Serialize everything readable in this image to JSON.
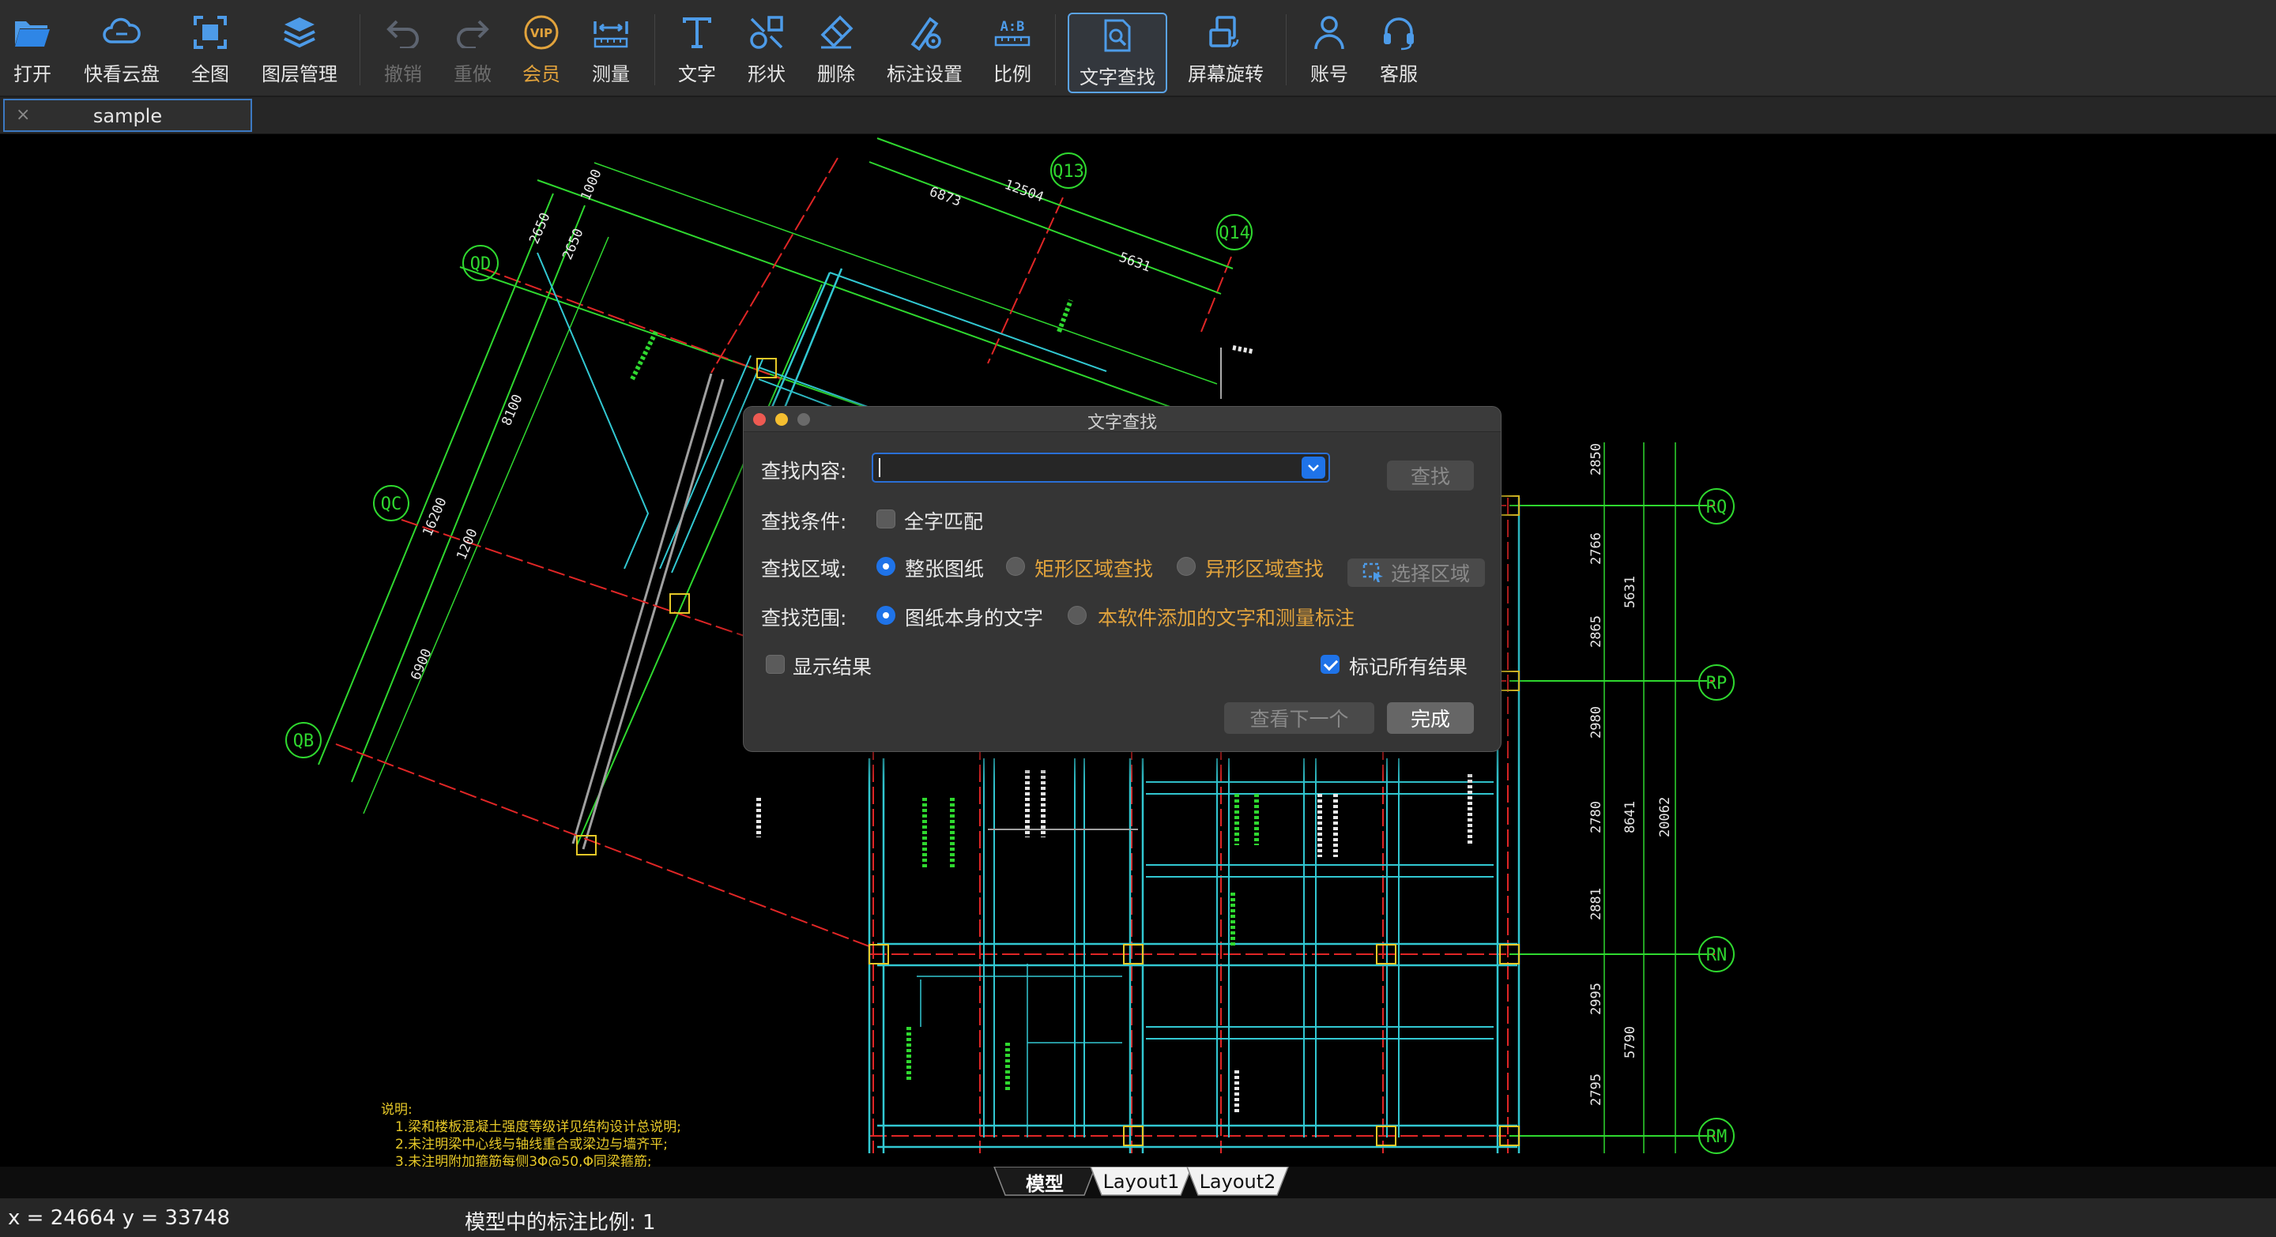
{
  "toolbar": {
    "items": [
      {
        "label": "打开",
        "icon": "folder-open-icon"
      },
      {
        "label": "快看云盘",
        "icon": "cloud-icon"
      },
      {
        "label": "全图",
        "icon": "fit-view-icon"
      },
      {
        "label": "图层管理",
        "icon": "layers-icon"
      },
      {
        "label": "撤销",
        "icon": "undo-icon",
        "disabled": true
      },
      {
        "label": "重做",
        "icon": "redo-icon",
        "disabled": true
      },
      {
        "label": "会员",
        "icon": "vip-icon"
      },
      {
        "label": "测量",
        "icon": "ruler-icon"
      },
      {
        "label": "文字",
        "icon": "text-icon"
      },
      {
        "label": "形状",
        "icon": "shape-icon"
      },
      {
        "label": "删除",
        "icon": "eraser-icon"
      },
      {
        "label": "标注设置",
        "icon": "annotation-settings-icon"
      },
      {
        "label": "比例",
        "icon": "scale-icon"
      },
      {
        "label": "文字查找",
        "icon": "text-search-icon",
        "active": true
      },
      {
        "label": "屏幕旋转",
        "icon": "screen-rotate-icon"
      },
      {
        "label": "账号",
        "icon": "account-icon"
      },
      {
        "label": "客服",
        "icon": "headset-icon"
      }
    ]
  },
  "tab": {
    "name": "sample",
    "close": "×"
  },
  "drawing": {
    "axes": [
      "QD",
      "QC",
      "QB",
      "Q13",
      "Q14",
      "RQ",
      "RP",
      "RN",
      "RM"
    ],
    "dims_top": [
      "6873",
      "12504",
      "5631"
    ],
    "dims_left": [
      "1000",
      "2650",
      "2650",
      "8100",
      "16200",
      "1200",
      "6900"
    ],
    "dims_right": [
      "2850",
      "2766",
      "2865",
      "2980",
      "2780",
      "2881",
      "2995",
      "2795",
      "5631",
      "8641",
      "20062",
      "5790"
    ],
    "notes_title": "说明:",
    "notes": [
      "1.梁和楼板混凝土强度等级详见结构设计总说明;",
      "2.未注明梁中心线与轴线重合或梁边与墙齐平;",
      "3.未注明附加箍筋每侧3Φ@50,Φ同梁箍筋;"
    ]
  },
  "dialog": {
    "title": "文字查找",
    "search_label": "查找内容:",
    "search_value": "",
    "search_button": "查找",
    "condition_label": "查找条件:",
    "whole_word": "全字匹配",
    "area_label": "查找区域:",
    "area_options": [
      "整张图纸",
      "矩形区域查找",
      "异形区域查找"
    ],
    "select_area": "选择区域",
    "scope_label": "查找范围:",
    "scope_options": [
      "图纸本身的文字",
      "本软件添加的文字和测量标注"
    ],
    "show_results": "显示结果",
    "mark_all": "标记所有结果",
    "next_button": "查看下一个",
    "done_button": "完成"
  },
  "layout_tabs": [
    "模型",
    "Layout1",
    "Layout2"
  ],
  "status": {
    "coords": "x = 24664  y = 33748",
    "scale": "模型中的标注比例:  1"
  },
  "colors": {
    "accent": "#1f73e8",
    "vip": "#e2a33c",
    "cad_green": "#2fd82f",
    "cad_cyan": "#32c8d2",
    "cad_red": "#e02626",
    "cad_yellow": "#e6c828"
  }
}
